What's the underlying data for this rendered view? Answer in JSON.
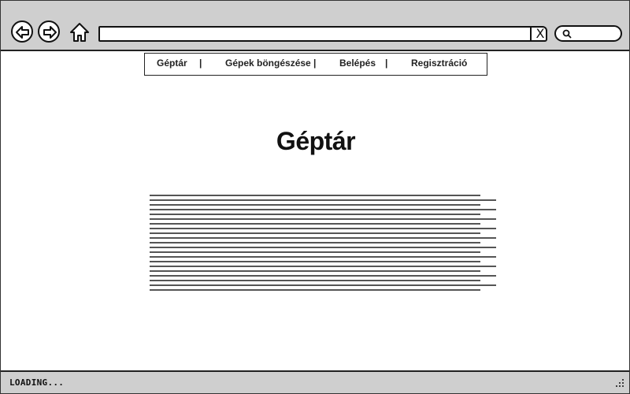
{
  "browser": {
    "address_value": "",
    "clear_symbol": "X",
    "search_value": ""
  },
  "menu": {
    "items": [
      {
        "label": "Géptár"
      },
      {
        "label": "Gépek böngészése"
      },
      {
        "label": "Belépés"
      },
      {
        "label": "Regisztráció"
      }
    ],
    "separator": "|"
  },
  "page": {
    "title": "Géptár"
  },
  "status": {
    "text": "LOADING..."
  },
  "icons": {
    "back": "arrow-left-icon",
    "forward": "arrow-right-icon",
    "home": "home-icon",
    "search": "search-icon",
    "resize": "resize-grip-icon"
  }
}
